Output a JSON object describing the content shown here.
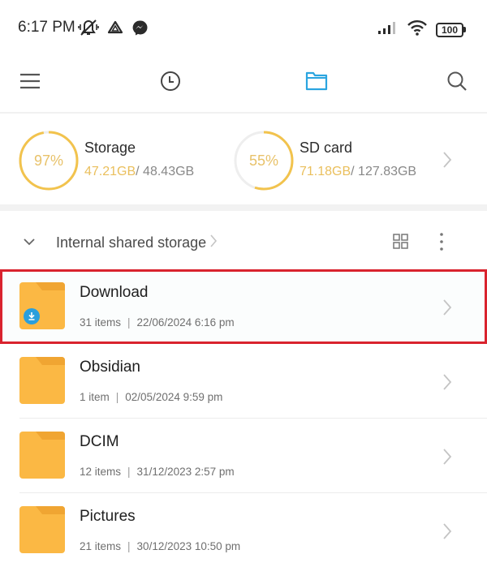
{
  "status_bar": {
    "time": "6:17 PM",
    "left_icons": [
      "vibrate-off-icon",
      "drive-icon",
      "messenger-icon"
    ],
    "right_icons": [
      "signal-icon",
      "wifi-icon",
      "battery-icon"
    ],
    "battery_level": "100"
  },
  "toolbar": {
    "items": [
      {
        "name": "menu",
        "icon": "hamburger-menu-icon"
      },
      {
        "name": "recent",
        "icon": "clock-icon"
      },
      {
        "name": "files",
        "icon": "folder-icon",
        "active": true
      },
      {
        "name": "search",
        "icon": "search-icon"
      }
    ],
    "active_color": "#2ba5e0"
  },
  "storage": [
    {
      "title": "Storage",
      "percent": "97%",
      "fraction": 0.97,
      "used": "47.21GB",
      "total": "/ 48.43GB"
    },
    {
      "title": "SD card",
      "percent": "55%",
      "fraction": 0.55,
      "used": "71.18GB",
      "total": "/ 127.83GB"
    }
  ],
  "location": {
    "path": "Internal shared storage",
    "separator": "›"
  },
  "files": [
    {
      "name": "Download",
      "count": "31 items",
      "date": "22/06/2024 6:16 pm",
      "badge": "download-icon",
      "highlighted": true
    },
    {
      "name": "Obsidian",
      "count": "1 item",
      "date": "02/05/2024 9:59 pm"
    },
    {
      "name": "DCIM",
      "count": "12 items",
      "date": "31/12/2023 2:57 pm"
    },
    {
      "name": "Pictures",
      "count": "21 items",
      "date": "30/12/2023 10:50 pm"
    }
  ],
  "meta_separator": "|",
  "colors": {
    "folder": "#fbb844",
    "folder_tab": "#f0a532",
    "ring_fill": "#f2c34d",
    "ring_track": "#eeeeee",
    "highlight_border": "#d9232e",
    "download_badge": "#2a9fdc"
  }
}
